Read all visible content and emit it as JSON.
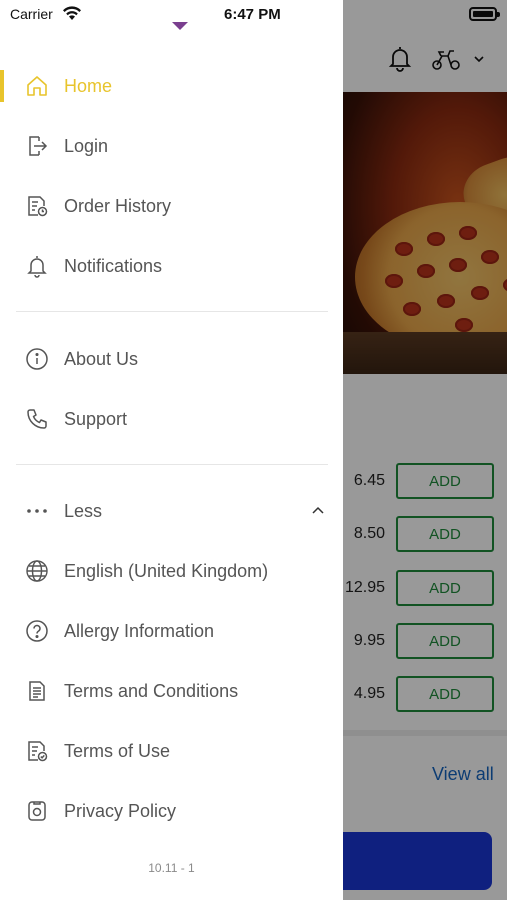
{
  "status_bar": {
    "carrier": "Carrier",
    "time": "6:47 PM"
  },
  "drawer": {
    "active_color": "#e8c42c",
    "primary_items": [
      {
        "label": "Home",
        "icon": "home-icon",
        "active": true
      },
      {
        "label": "Login",
        "icon": "login-icon",
        "active": false
      },
      {
        "label": "Order History",
        "icon": "order-history-icon",
        "active": false
      },
      {
        "label": "Notifications",
        "icon": "bell-icon",
        "active": false
      }
    ],
    "secondary_items": [
      {
        "label": "About Us",
        "icon": "info-icon"
      },
      {
        "label": "Support",
        "icon": "phone-icon"
      }
    ],
    "less_toggle": {
      "label": "Less",
      "icon": "more-dots-icon",
      "chevron": "chevron-up-icon"
    },
    "more_items": [
      {
        "label": "English (United Kingdom)",
        "icon": "globe-icon"
      },
      {
        "label": "Allergy Information",
        "icon": "question-icon"
      },
      {
        "label": "Terms and Conditions",
        "icon": "document-icon"
      },
      {
        "label": "Terms of Use",
        "icon": "document-check-icon"
      },
      {
        "label": "Privacy Policy",
        "icon": "privacy-icon"
      }
    ],
    "version": "10.11 - 1"
  },
  "background": {
    "header_icons": [
      "bell-icon",
      "scooter-icon",
      "chevron-down-icon"
    ],
    "products": [
      {
        "price": "6.45",
        "button": "ADD"
      },
      {
        "price": "8.50",
        "button": "ADD"
      },
      {
        "price": "12.95",
        "button": "ADD"
      },
      {
        "price": "9.95",
        "button": "ADD"
      },
      {
        "price": "4.95",
        "button": "ADD"
      }
    ],
    "view_all": "View all",
    "accent_color": "#1f8a3b",
    "link_color": "#1565c0",
    "cta_color": "#1a36d4"
  }
}
